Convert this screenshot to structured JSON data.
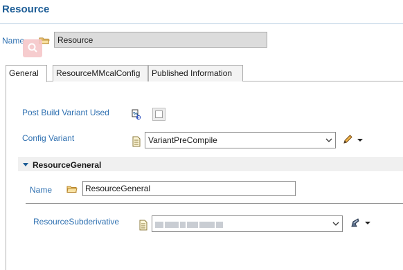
{
  "header": {
    "title": "Resource"
  },
  "name_row": {
    "label": "Name",
    "value": "Resource"
  },
  "tabs": [
    {
      "label": "General",
      "active": true
    },
    {
      "label": "ResourceMMcalConfig",
      "active": false
    },
    {
      "label": "Published Information",
      "active": false
    }
  ],
  "general": {
    "post_build_label": "Post Build Variant Used",
    "post_build_checked": false,
    "config_variant_label": "Config Variant",
    "config_variant_value": "VariantPreCompile"
  },
  "section": {
    "title": "ResourceGeneral",
    "name_label": "Name",
    "name_value": "ResourceGeneral",
    "subderivative_label": "ResourceSubderivative",
    "subderivative_value": ""
  },
  "colors": {
    "accent": "#1d5d96",
    "label_blue": "#2d6fb0",
    "field_gray": "#dcdcdc"
  },
  "icons": [
    "folder-icon",
    "variant-icon",
    "document-icon",
    "pencil-icon",
    "link-icon",
    "chevron-down-icon",
    "collapse-triangle-icon"
  ]
}
